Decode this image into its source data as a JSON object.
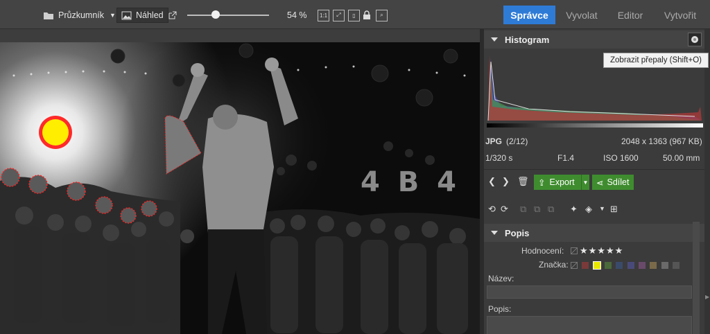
{
  "toolbar": {
    "browser_label": "Průzkumník",
    "preview_label": "Náhled",
    "zoom": "54 %",
    "zoom_ratio_label": "1:1"
  },
  "modes": {
    "active": "Správce",
    "develop": "Vyvolat",
    "editor": "Editor",
    "create": "Vytvořit",
    "active_color": "#2e7bd6"
  },
  "histogram": {
    "title": "Histogram",
    "tooltip": "Zobrazit přepaly (Shift+O)"
  },
  "file_info": {
    "format": "JPG",
    "index": "(2/12)",
    "dimensions": "2048 x 1363 (967 KB)",
    "shutter": "1/320 s",
    "aperture": "F1.4",
    "iso": "ISO 1600",
    "focal": "50.00 mm"
  },
  "actions": {
    "export_label": "Export",
    "share_label": "Sdílet",
    "button_color": "#3f8c2f"
  },
  "description": {
    "title": "Popis",
    "rating_label": "Hodnocení:",
    "tag_label": "Značka:",
    "name_label": "Název:",
    "desc_label": "Popis:",
    "tag_colors": [
      "#7a3a3a",
      "#e8e800",
      "#4a6a3a",
      "#3a4a6a",
      "#4a4a7a",
      "#6a4a6a",
      "#7a6a4a",
      "#6a6a6a",
      "#555555"
    ]
  },
  "photo": {
    "sign_text": "4 B 4"
  }
}
